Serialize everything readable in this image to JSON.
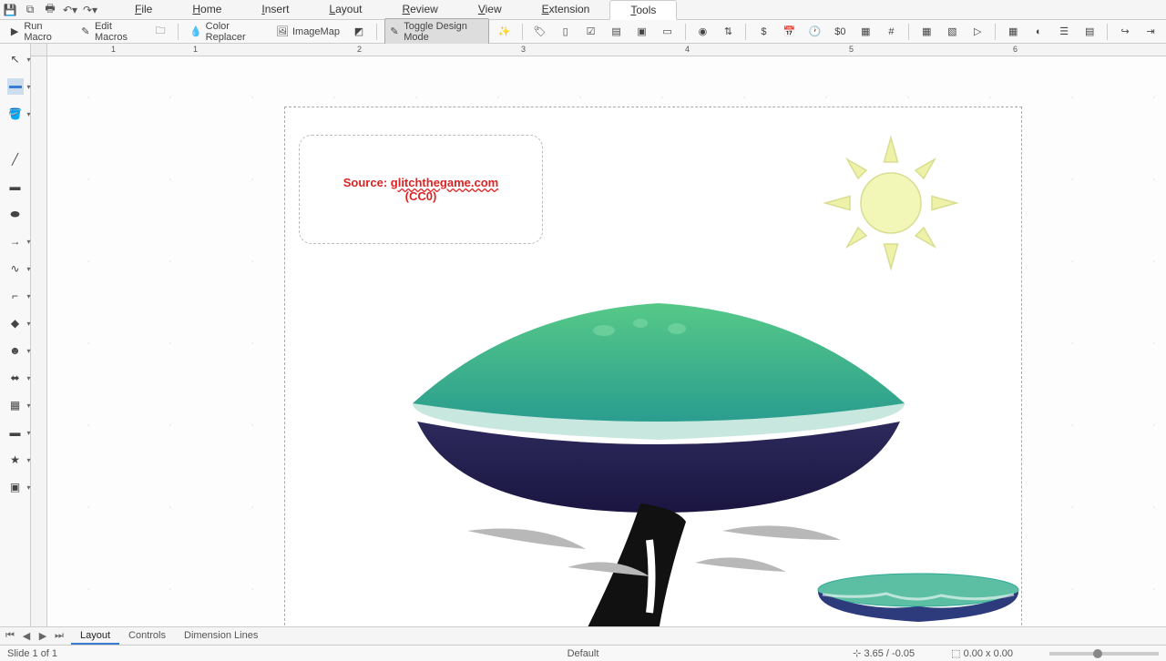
{
  "menubar": {
    "items": [
      {
        "label": "File",
        "u": "F"
      },
      {
        "label": "Home",
        "u": "H"
      },
      {
        "label": "Insert",
        "u": "I"
      },
      {
        "label": "Layout",
        "u": "L"
      },
      {
        "label": "Review",
        "u": "R"
      },
      {
        "label": "View",
        "u": "V"
      },
      {
        "label": "Extension",
        "u": "E"
      },
      {
        "label": "Tools",
        "u": "T"
      }
    ],
    "active": 7
  },
  "toolbar": {
    "run_macro": "Run Macro",
    "edit_macros": "Edit Macros",
    "color_replacer": "Color Replacer",
    "image_map": "ImageMap",
    "toggle_design": "Toggle Design Mode"
  },
  "ruler": {
    "marks": [
      "1",
      "1",
      "2",
      "3",
      "4",
      "5",
      "6"
    ]
  },
  "slide_text": {
    "line1_pre": "Source: ",
    "line1_url": "glitchthegame.com",
    "line2": "(CC0)"
  },
  "tabs": {
    "items": [
      "Layout",
      "Controls",
      "Dimension Lines"
    ],
    "active": 0
  },
  "status": {
    "slide": "Slide 1 of 1",
    "master": "Default",
    "coords": "3.65 / -0.05",
    "size": "0.00 x 0.00"
  }
}
